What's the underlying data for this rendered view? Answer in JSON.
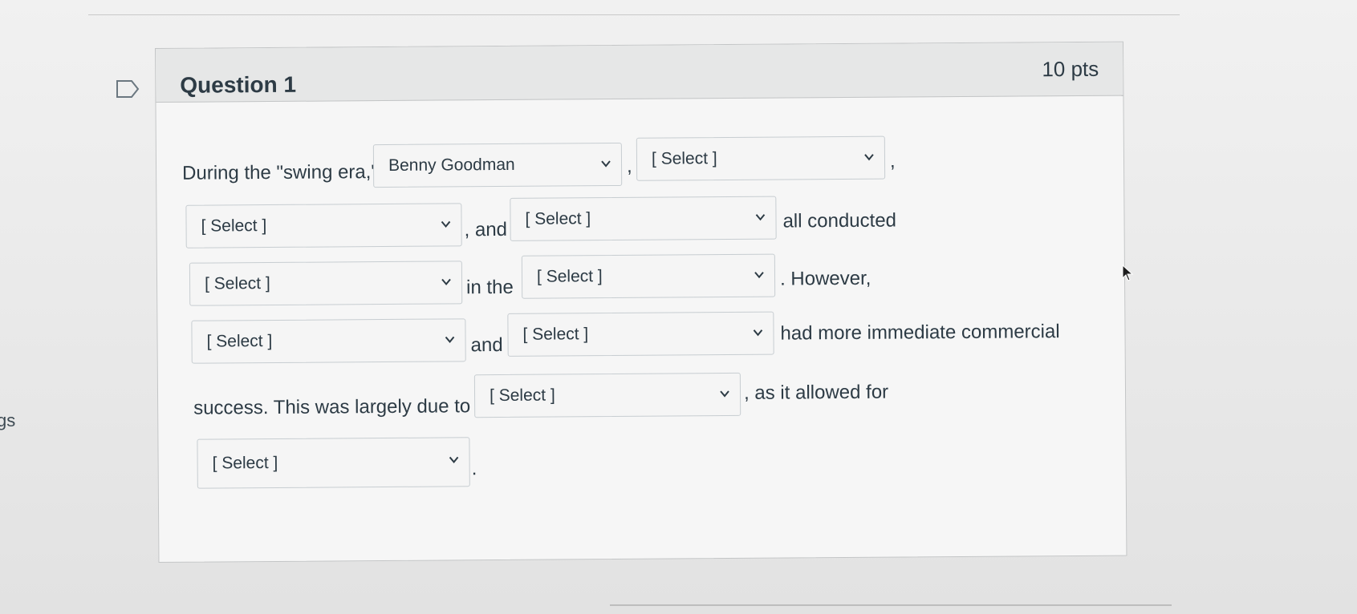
{
  "left_edge_text": "gs",
  "question": {
    "title": "Question 1",
    "points": "10 pts"
  },
  "text": {
    "during": "During the \"swing era,\"",
    "comma1": ",",
    "comma2": ",",
    "and1": ", and",
    "all_conducted": "all conducted",
    "in_the": "in the",
    "however": ". However,",
    "and2": "and",
    "had_more": "had more immediate commercial",
    "success": "success. This was largely due to",
    "as_it": ", as it allowed for",
    "period": "."
  },
  "selects": {
    "s1": "Benny Goodman",
    "s2": "[ Select ]",
    "s3": "[ Select ]",
    "s4": "[ Select ]",
    "s5": "[ Select ]",
    "s6": "[ Select ]",
    "s7": "[ Select ]",
    "s8": "[ Select ]",
    "s9": "[ Select ]",
    "s10": "[ Select ]"
  },
  "colors": {
    "text": "#2d3b45",
    "header_bg": "#e6e7e7",
    "border": "#c3c5c6"
  },
  "icons": {
    "flag": "flag-icon",
    "dropdown": "chevron-down-icon",
    "cursor": "mouse-cursor-icon"
  }
}
